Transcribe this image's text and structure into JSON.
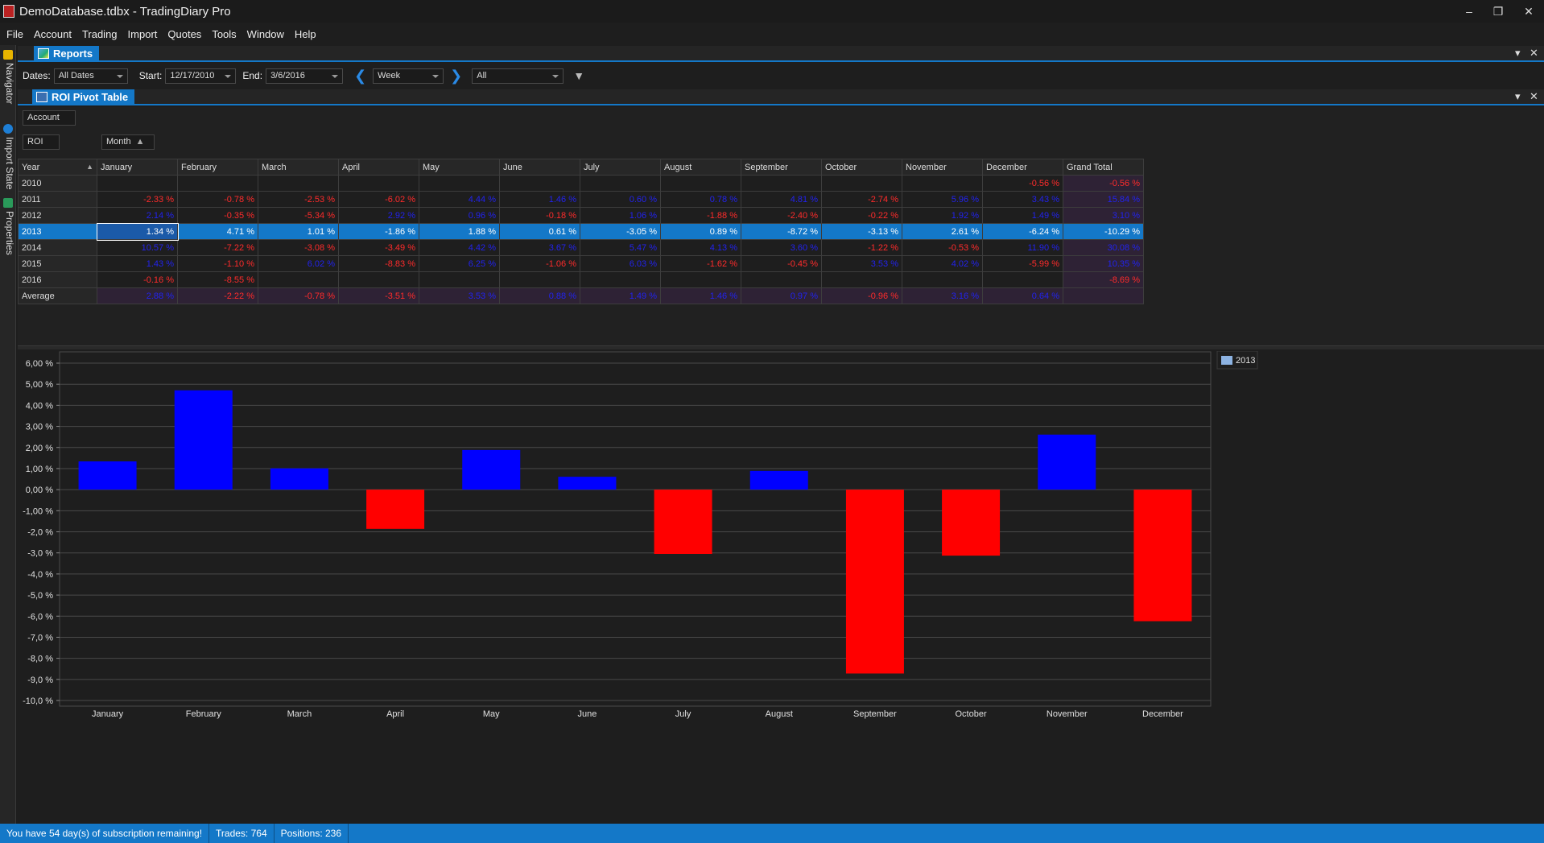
{
  "window": {
    "title": "DemoDatabase.tdbx - TradingDiary Pro",
    "minimize": "–",
    "restore": "❐",
    "close": "✕"
  },
  "menu": [
    "File",
    "Account",
    "Trading",
    "Import",
    "Quotes",
    "Tools",
    "Window",
    "Help"
  ],
  "dock": {
    "tabs": [
      "Navigator",
      "Import State",
      "Properties"
    ]
  },
  "reports": {
    "tab_label": "Reports"
  },
  "toolbar": {
    "dates_label": "Dates:",
    "dates_value": "All Dates",
    "start_label": "Start:",
    "start_value": "12/17/2010",
    "end_label": "End:",
    "end_value": "3/6/2016",
    "period_value": "Week",
    "filter_value": "All"
  },
  "pivot": {
    "tab_label": "ROI Pivot Table",
    "filter_field": "Account",
    "data_field": "ROI",
    "column_field": "Month",
    "row_field": "Year",
    "columns": [
      "January",
      "February",
      "March",
      "April",
      "May",
      "June",
      "July",
      "August",
      "September",
      "October",
      "November",
      "December",
      "Grand Total"
    ],
    "rows": [
      {
        "label": "2010",
        "cells": [
          "",
          "",
          "",
          "",
          "",
          "",
          "",
          "",
          "",
          "",
          "",
          "-0.56 %",
          "-0.56 %"
        ]
      },
      {
        "label": "2011",
        "cells": [
          "-2.33 %",
          "-0.78 %",
          "-2.53 %",
          "-6.02 %",
          "4.44 %",
          "1.46 %",
          "0.60 %",
          "0.78 %",
          "4.81 %",
          "-2.74 %",
          "5.96 %",
          "3.43 %",
          "15.84 %"
        ]
      },
      {
        "label": "2012",
        "cells": [
          "2.14 %",
          "-0.35 %",
          "-5.34 %",
          "2.92 %",
          "0.96 %",
          "-0.18 %",
          "1.06 %",
          "-1.88 %",
          "-2.40 %",
          "-0.22 %",
          "1.92 %",
          "1.49 %",
          "3.10 %"
        ]
      },
      {
        "label": "2013",
        "cells": [
          "1.34 %",
          "4.71 %",
          "1.01 %",
          "-1.86 %",
          "1.88 %",
          "0.61 %",
          "-3.05 %",
          "0.89 %",
          "-8.72 %",
          "-3.13 %",
          "2.61 %",
          "-6.24 %",
          "-10.29 %"
        ]
      },
      {
        "label": "2014",
        "cells": [
          "10.57 %",
          "-7.22 %",
          "-3.08 %",
          "-3.49 %",
          "4.42 %",
          "3.67 %",
          "5.47 %",
          "4.13 %",
          "3.60 %",
          "-1.22 %",
          "-0.53 %",
          "11.90 %",
          "30.08 %"
        ]
      },
      {
        "label": "2015",
        "cells": [
          "1.43 %",
          "-1.10 %",
          "6.02 %",
          "-8.83 %",
          "6.25 %",
          "-1.06 %",
          "6.03 %",
          "-1.62 %",
          "-0.45 %",
          "3.53 %",
          "4.02 %",
          "-5.99 %",
          "10.35 %"
        ]
      },
      {
        "label": "2016",
        "cells": [
          "-0.16 %",
          "-8.55 %",
          "",
          "",
          "",
          "",
          "",
          "",
          "",
          "",
          "",
          "",
          "-8.69 %"
        ]
      },
      {
        "label": "Average",
        "cells": [
          "2.88 %",
          "-2.22 %",
          "-0.78 %",
          "-3.51 %",
          "3.53 %",
          "0.88 %",
          "1.49 %",
          "1.46 %",
          "0.97 %",
          "-0.96 %",
          "3.16 %",
          "0.64 %",
          ""
        ]
      }
    ],
    "selected_row": "2013"
  },
  "chart_data": {
    "type": "bar",
    "series": [
      {
        "name": "2013",
        "values": [
          1.34,
          4.71,
          1.01,
          -1.86,
          1.88,
          0.61,
          -3.05,
          0.89,
          -8.72,
          -3.13,
          2.61,
          -6.24
        ]
      }
    ],
    "categories": [
      "January",
      "February",
      "March",
      "April",
      "May",
      "June",
      "July",
      "August",
      "September",
      "October",
      "November",
      "December"
    ],
    "ylim": [
      -10,
      6
    ],
    "yticks": [
      "6,00 %",
      "5,00 %",
      "4,00 %",
      "3,00 %",
      "2,00 %",
      "1,00 %",
      "0,00 %",
      "-1,00 %",
      "-2,0 %",
      "-3,0 %",
      "-4,0 %",
      "-5,0 %",
      "-6,0 %",
      "-7,0 %",
      "-8,0 %",
      "-9,0 %",
      "-10,0 %"
    ],
    "ytick_values": [
      6,
      5,
      4,
      3,
      2,
      1,
      0,
      -1,
      -2,
      -3,
      -4,
      -5,
      -6,
      -7,
      -8,
      -9,
      -10
    ],
    "positive_color": "#0000ff",
    "negative_color": "#ff0000",
    "legend_color": "#8db3e2",
    "grid": true,
    "legend_position": "top-right"
  },
  "status": {
    "subscription": "You have 54 day(s) of subscription remaining!",
    "trades": "Trades: 764",
    "positions": "Positions: 236"
  }
}
